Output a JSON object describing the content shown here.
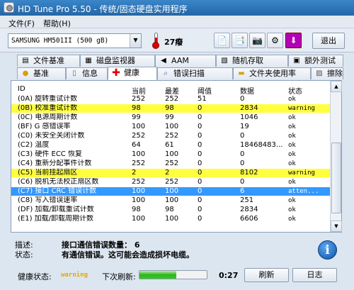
{
  "window": {
    "title": "HD Tune Pro 5.50 - 传统/固态硬盘实用程序"
  },
  "menu": {
    "file": "文件(F)",
    "help": "帮助(H)"
  },
  "toolbar": {
    "drive": "SAMSUNG HM501II (500 gB)",
    "temperature": "27癈",
    "exit_label": "退出"
  },
  "tabs_top": [
    {
      "label": "文件基准",
      "icon": "file-benchmark-icon"
    },
    {
      "label": "磁盘监视器",
      "icon": "disk-monitor-icon"
    },
    {
      "label": "AAM",
      "icon": "speaker-icon"
    },
    {
      "label": "随机存取",
      "icon": "random-access-icon"
    },
    {
      "label": "额外测试",
      "icon": "extra-tests-icon"
    }
  ],
  "tabs_bottom": [
    {
      "label": "基准",
      "icon": "benchmark-icon"
    },
    {
      "label": "信息",
      "icon": "info-icon"
    },
    {
      "label": "健康",
      "icon": "health-cross-icon"
    },
    {
      "label": "错误扫描",
      "icon": "error-scan-icon"
    },
    {
      "label": "文件夹使用率",
      "icon": "folder-usage-icon"
    },
    {
      "label": "擦除",
      "icon": "erase-icon"
    }
  ],
  "grid": {
    "headers": [
      "ID",
      "当前",
      "最差",
      "阈值",
      "数据",
      "状态"
    ],
    "rows": [
      {
        "id": "(0A) 旋转重试计数",
        "cur": "252",
        "worst": "252",
        "thr": "51",
        "data": "0",
        "status": "ok",
        "state": "normal"
      },
      {
        "id": "(0B) 校准重试计数",
        "cur": "98",
        "worst": "98",
        "thr": "0",
        "data": "2834",
        "status": "warning",
        "state": "warn"
      },
      {
        "id": "(0C) 电源周期计数",
        "cur": "99",
        "worst": "99",
        "thr": "0",
        "data": "1046",
        "status": "ok",
        "state": "normal"
      },
      {
        "id": "(BF) G 感错误率",
        "cur": "100",
        "worst": "100",
        "thr": "0",
        "data": "19",
        "status": "ok",
        "state": "normal"
      },
      {
        "id": "(C0) 未安全关闭计数",
        "cur": "252",
        "worst": "252",
        "thr": "0",
        "data": "0",
        "status": "ok",
        "state": "normal"
      },
      {
        "id": "(C2) 温度",
        "cur": "64",
        "worst": "61",
        "thr": "0",
        "data": "18468483...",
        "status": "ok",
        "state": "normal"
      },
      {
        "id": "(C3) 硬件 ECC 恢复",
        "cur": "100",
        "worst": "100",
        "thr": "0",
        "data": "0",
        "status": "ok",
        "state": "normal"
      },
      {
        "id": "(C4) 重新分配事件计数",
        "cur": "252",
        "worst": "252",
        "thr": "0",
        "data": "0",
        "status": "ok",
        "state": "normal"
      },
      {
        "id": "(C5) 当前挂起扇区",
        "cur": "2",
        "worst": "2",
        "thr": "0",
        "data": "8102",
        "status": "warning",
        "state": "warn"
      },
      {
        "id": "(C6) 脱机无法校正扇区数",
        "cur": "252",
        "worst": "252",
        "thr": "0",
        "data": "0",
        "status": "ok",
        "state": "normal"
      },
      {
        "id": "(C7) 接口 CRC 错误计数",
        "cur": "100",
        "worst": "100",
        "thr": "0",
        "data": "6",
        "status": "atten...",
        "state": "selected"
      },
      {
        "id": "(C8) 写入错误速率",
        "cur": "100",
        "worst": "100",
        "thr": "0",
        "data": "251",
        "status": "ok",
        "state": "normal"
      },
      {
        "id": "(DF) 加载/卸载重试计数",
        "cur": "98",
        "worst": "98",
        "thr": "0",
        "data": "2834",
        "status": "ok",
        "state": "normal"
      },
      {
        "id": "(E1) 加载/卸载周期计数",
        "cur": "100",
        "worst": "100",
        "thr": "0",
        "data": "6606",
        "status": "ok",
        "state": "normal"
      }
    ]
  },
  "description": {
    "desc_label": "描述:",
    "desc_value": "接口通信错误数量： 6",
    "status_label": "状态:",
    "status_value": "有通信错误。这可能会造成损坏电缆。"
  },
  "footer": {
    "health_label": "健康状态:",
    "health_value": "warning",
    "next_refresh_label": "下次刷新:",
    "progress_fraction": 0.55,
    "timer": "0:27",
    "refresh_label": "刷新",
    "log_label": "日志"
  },
  "colors": {
    "warning_row": "#ffff40",
    "selected_row": "#3399ff",
    "progress": "#2fb51f"
  }
}
